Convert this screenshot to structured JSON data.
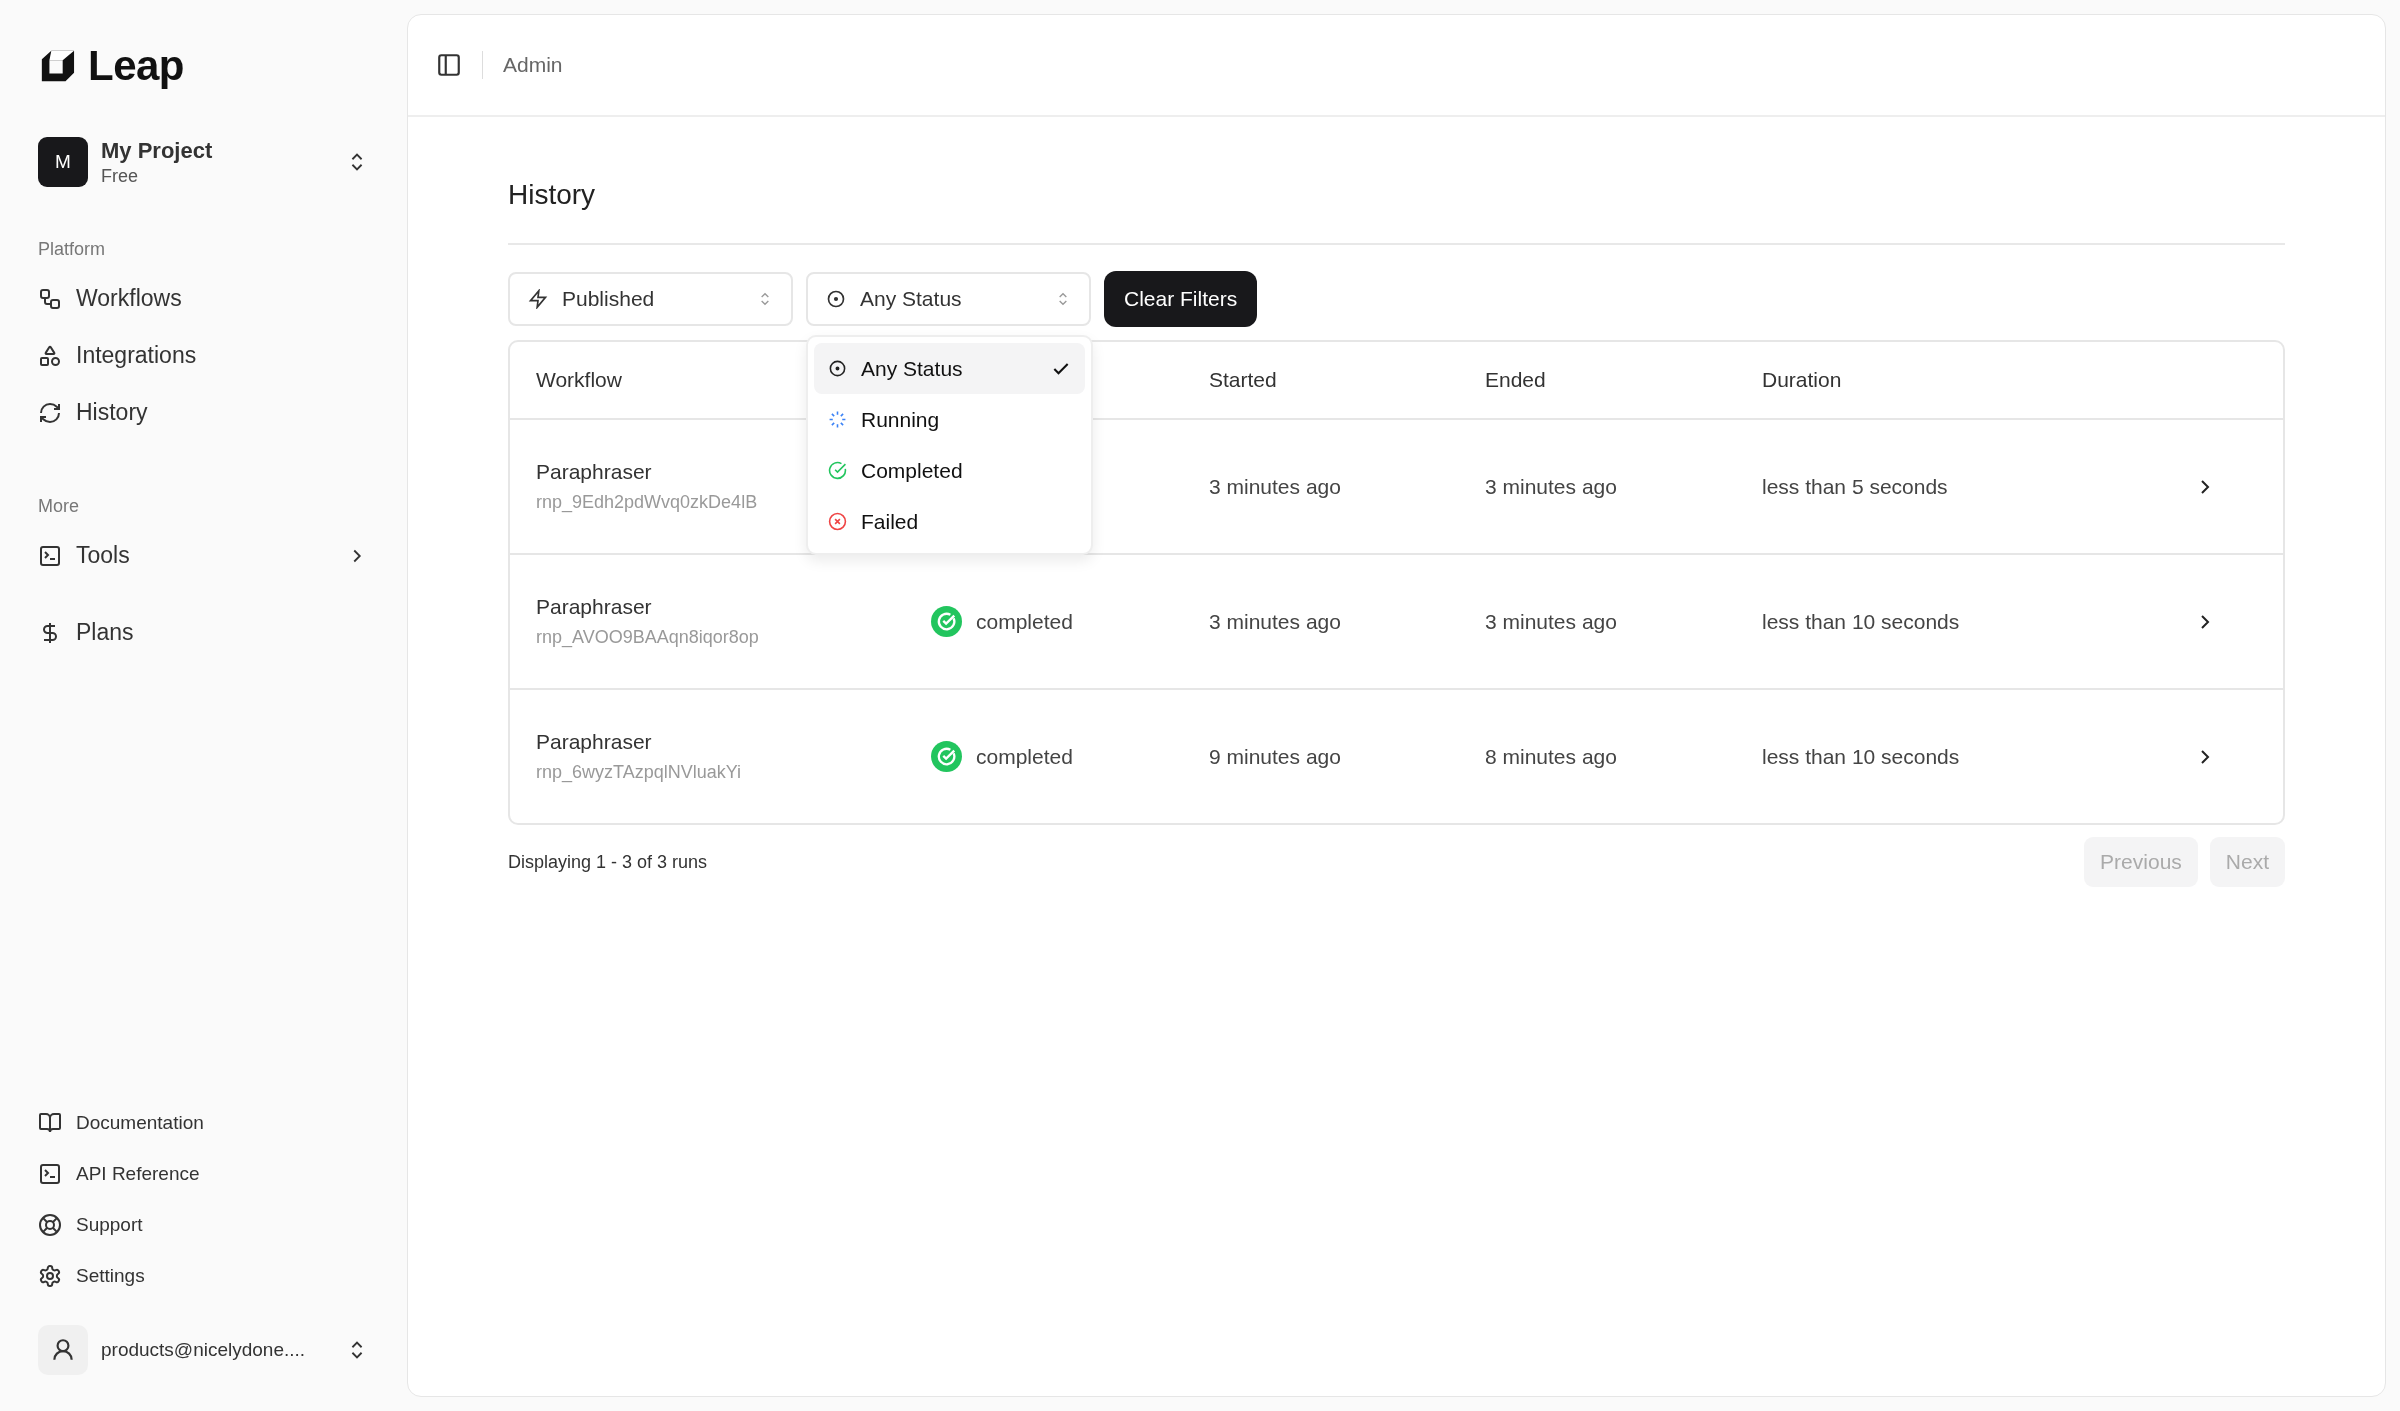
{
  "sidebar": {
    "logo": "Leap",
    "project": {
      "initial": "M",
      "name": "My Project",
      "plan": "Free"
    },
    "sections": [
      {
        "heading": "Platform",
        "items": [
          {
            "label": "Workflows",
            "submenu": false
          },
          {
            "label": "Integrations",
            "submenu": false
          },
          {
            "label": "History",
            "submenu": false
          }
        ]
      },
      {
        "heading": "More",
        "items": [
          {
            "label": "Tools",
            "submenu": true
          },
          {
            "label": "Plans",
            "submenu": false
          }
        ]
      }
    ],
    "footer_links": [
      {
        "label": "Documentation"
      },
      {
        "label": "API Reference"
      },
      {
        "label": "Support"
      },
      {
        "label": "Settings"
      }
    ],
    "user": {
      "email": "products@nicelydone...."
    }
  },
  "header": {
    "breadcrumb": "Admin"
  },
  "page": {
    "title": "History"
  },
  "filters": {
    "workflow_filter": "Published",
    "status_filter": "Any Status",
    "clear_button": "Clear Filters"
  },
  "status_menu": [
    {
      "label": "Any Status",
      "kind": "any",
      "selected": true
    },
    {
      "label": "Running",
      "kind": "running",
      "selected": false
    },
    {
      "label": "Completed",
      "kind": "completed",
      "selected": false
    },
    {
      "label": "Failed",
      "kind": "failed",
      "selected": false
    }
  ],
  "table": {
    "columns": [
      "Workflow",
      "Started",
      "Ended",
      "Duration"
    ],
    "rows": [
      {
        "workflow": "Paraphraser",
        "run_id": "rnp_9Edh2pdWvq0zkDe4lB",
        "started": "3 minutes ago",
        "ended": "3 minutes ago",
        "duration": "less than 5 seconds"
      },
      {
        "workflow": "Paraphraser",
        "run_id": "rnp_AVOO9BAAqn8iqor8op",
        "status": "completed",
        "started": "3 minutes ago",
        "ended": "3 minutes ago",
        "duration": "less than 10 seconds"
      },
      {
        "workflow": "Paraphraser",
        "run_id": "rnp_6wyzTAzpqlNVluakYi",
        "status": "completed",
        "started": "9 minutes ago",
        "ended": "8 minutes ago",
        "duration": "less than 10 seconds"
      }
    ]
  },
  "pagination": {
    "summary": "Displaying 1 - 3 of 3 runs",
    "previous": {
      "label": "Previous",
      "disabled": true
    },
    "next": {
      "label": "Next",
      "disabled": true
    }
  }
}
